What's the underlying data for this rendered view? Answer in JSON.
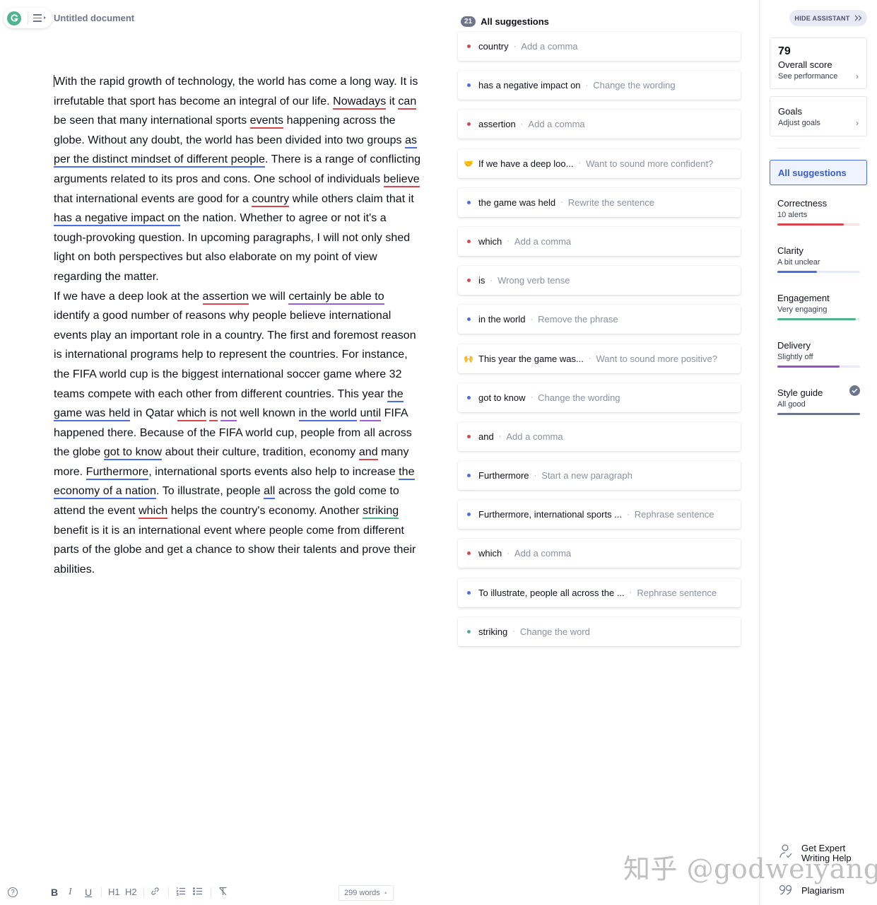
{
  "header": {
    "doc_title": "Untitled document"
  },
  "document": {
    "paragraphs": [
      [
        {
          "t": "With the rapid growth of technology, the world has come a long way. It is irrefutable that sport has become an integral of our life. "
        },
        {
          "t": "Nowadays",
          "u": "red"
        },
        {
          "t": " it "
        },
        {
          "t": "can",
          "u": "red"
        },
        {
          "t": " be seen that many international sports "
        },
        {
          "t": "events",
          "u": "red"
        },
        {
          "t": " happening across the globe. Without any doubt, the world has been divided into two groups "
        },
        {
          "t": "as per the distinct mindset of different people",
          "u": "blue"
        },
        {
          "t": ". There is a range of conflicting arguments related to its pros and cons. One school of individuals "
        },
        {
          "t": "believe",
          "u": "red"
        },
        {
          "t": " that international events are good for a "
        },
        {
          "t": "country",
          "u": "red"
        },
        {
          "t": " while others claim that it "
        },
        {
          "t": "has a negative impact on",
          "u": "blue"
        },
        {
          "t": " the nation. Whether to agree or not it's a tough-provoking question. In upcoming paragraphs, I will not only shed light on both perspectives but also elaborate on my point of view regarding the matter."
        }
      ],
      [
        {
          "t": "If we have a deep look at the "
        },
        {
          "t": "assertion",
          "u": "red"
        },
        {
          "t": " we will "
        },
        {
          "t": "certainly be able to",
          "u": "purple"
        },
        {
          "t": " identify a good number of reasons why people believe international events play an important role in a country. The first and foremost reason is international programs help to represent the countries. For instance, the FIFA world cup is the biggest international soccer game where 32 teams compete with each other from different countries. This year "
        },
        {
          "t": "the game was held",
          "u": "blue"
        },
        {
          "t": " in Qatar "
        },
        {
          "t": "which",
          "u": "red"
        },
        {
          "t": " "
        },
        {
          "t": "is",
          "u": "red"
        },
        {
          "t": " "
        },
        {
          "t": "not",
          "u": "purple"
        },
        {
          "t": " well known "
        },
        {
          "t": "in the world",
          "u": "blue"
        },
        {
          "t": " "
        },
        {
          "t": "until",
          "u": "purple"
        },
        {
          "t": " FIFA happened there. Because of the FIFA world cup, people from all across the globe "
        },
        {
          "t": "got to know",
          "u": "blue"
        },
        {
          "t": " about their culture, tradition, economy "
        },
        {
          "t": "and",
          "u": "red"
        },
        {
          "t": " many more. "
        },
        {
          "t": "Furthermore",
          "u": "blue"
        },
        {
          "t": ", international sports events also help to increase "
        },
        {
          "t": "the economy of a nation",
          "u": "blue"
        },
        {
          "t": ". To illustrate, people "
        },
        {
          "t": "all",
          "u": "blue"
        },
        {
          "t": " across the gold come to attend the event "
        },
        {
          "t": "which",
          "u": "red"
        },
        {
          "t": " helps the country's economy. Another "
        },
        {
          "t": "striking",
          "u": "green"
        },
        {
          "t": " benefit is it is an international event where people come from different parts of the globe and get a chance to show their talents and prove their abilities."
        }
      ]
    ]
  },
  "suggestions": {
    "count": "21",
    "title": "All suggestions",
    "items": [
      {
        "marker": "dot",
        "color": "#d8474e",
        "word": "country",
        "hint": "Add a comma"
      },
      {
        "marker": "dot",
        "color": "#4a6ee0",
        "word": "has a negative impact on",
        "hint": "Change the wording"
      },
      {
        "marker": "dot",
        "color": "#d8474e",
        "word": "assertion",
        "hint": "Add a comma"
      },
      {
        "marker": "emoji",
        "emoji": "🤝",
        "word": "If we have a deep loo...",
        "hint": "Want to sound more confident?"
      },
      {
        "marker": "dot",
        "color": "#4a6ee0",
        "word": "the game was held",
        "hint": "Rewrite the sentence"
      },
      {
        "marker": "dot",
        "color": "#d8474e",
        "word": "which",
        "hint": "Add a comma"
      },
      {
        "marker": "dot",
        "color": "#d8474e",
        "word": "is",
        "hint": "Wrong verb tense"
      },
      {
        "marker": "dot",
        "color": "#4a6ee0",
        "word": "in the world",
        "hint": "Remove the phrase"
      },
      {
        "marker": "emoji",
        "emoji": "🙌",
        "word": "This year the game was...",
        "hint": "Want to sound more positive?"
      },
      {
        "marker": "dot",
        "color": "#4a6ee0",
        "word": "got to know",
        "hint": "Change the wording"
      },
      {
        "marker": "dot",
        "color": "#d8474e",
        "word": "and",
        "hint": "Add a comma"
      },
      {
        "marker": "dot",
        "color": "#4a6ee0",
        "word": "Furthermore",
        "hint": "Start a new paragraph"
      },
      {
        "marker": "dot",
        "color": "#4a6ee0",
        "word": "Furthermore, international sports ...",
        "hint": "Rephrase sentence"
      },
      {
        "marker": "dot",
        "color": "#d8474e",
        "word": "which",
        "hint": "Add a comma"
      },
      {
        "marker": "dot",
        "color": "#4a6ee0",
        "word": "To illustrate, people all across the ...",
        "hint": "Rephrase sentence"
      },
      {
        "marker": "dot",
        "color": "#4fb38a",
        "word": "striking",
        "hint": "Change the word"
      }
    ]
  },
  "assistant": {
    "hide_label": "HIDE ASSISTANT",
    "score": {
      "value": "79",
      "label": "Overall score",
      "link": "See performance"
    },
    "goals": {
      "label": "Goals",
      "link": "Adjust goals"
    },
    "all_suggestions": "All suggestions",
    "categories": [
      {
        "name": "Correctness",
        "status": "10 alerts",
        "color": "#d8474e",
        "track": "#fbe3e4",
        "level": 0.8
      },
      {
        "name": "Clarity",
        "status": "A bit unclear",
        "color": "#4a6ee0",
        "track": "#e3eafb",
        "level": 0.48
      },
      {
        "name": "Engagement",
        "status": "Very engaging",
        "color": "#4fb38a",
        "track": "#dff3ea",
        "level": 0.95
      },
      {
        "name": "Delivery",
        "status": "Slightly off",
        "color": "#8e55c7",
        "track": "#efe5fa",
        "level": 0.75
      },
      {
        "name": "Style guide",
        "status": "All good",
        "color": "#6d758d",
        "track": "#e4e6eb",
        "level": 1.0,
        "checked": true
      }
    ],
    "expert_line1": "Get Expert",
    "expert_line2": "Writing Help",
    "plagiarism": "Plagiarism"
  },
  "toolbar": {
    "help": "?",
    "bold": "B",
    "italic": "I",
    "underline": "U",
    "h1": "H1",
    "h2": "H2",
    "word_count": "299 words"
  },
  "watermark": "知乎 @godweiyang"
}
